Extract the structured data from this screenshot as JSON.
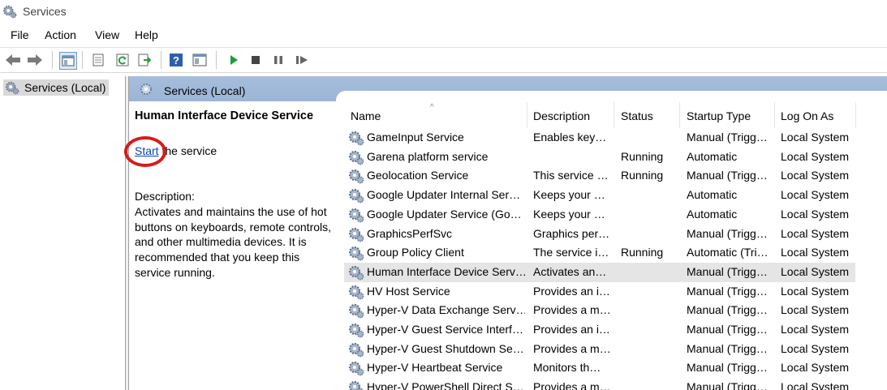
{
  "window": {
    "title": "Services"
  },
  "menu": [
    "File",
    "Action",
    "View",
    "Help"
  ],
  "tree": {
    "root_label": "Services (Local)"
  },
  "pane": {
    "header_label": "Services (Local)"
  },
  "extended": {
    "service_name": "Human Interface Device Service",
    "start_link": "Start",
    "start_suffix": " the service",
    "description_label": "Description:",
    "description": "Activates and maintains the use of hot buttons on keyboards, remote controls, and other multimedia devices. It is recommended that you keep this service running."
  },
  "columns": [
    "Name",
    "Description",
    "Status",
    "Startup Type",
    "Log On As"
  ],
  "rows": [
    {
      "name": "GameInput Service",
      "desc": "Enables key…",
      "status": "",
      "startup": "Manual (Trigg…",
      "logon": "Local System"
    },
    {
      "name": "Garena platform service",
      "desc": "",
      "status": "Running",
      "startup": "Automatic",
      "logon": "Local System"
    },
    {
      "name": "Geolocation Service",
      "desc": "This service …",
      "status": "Running",
      "startup": "Manual (Trigg…",
      "logon": "Local System"
    },
    {
      "name": "Google Updater Internal Ser…",
      "desc": "Keeps your …",
      "status": "",
      "startup": "Automatic",
      "logon": "Local System"
    },
    {
      "name": "Google Updater Service (Go…",
      "desc": "Keeps your …",
      "status": "",
      "startup": "Automatic",
      "logon": "Local System"
    },
    {
      "name": "GraphicsPerfSvc",
      "desc": "Graphics per…",
      "status": "",
      "startup": "Manual (Trigg…",
      "logon": "Local System"
    },
    {
      "name": "Group Policy Client",
      "desc": "The service i…",
      "status": "Running",
      "startup": "Automatic (Tri…",
      "logon": "Local System"
    },
    {
      "name": "Human Interface Device Serv…",
      "desc": "Activates an…",
      "status": "",
      "startup": "Manual (Trigg…",
      "logon": "Local System",
      "selected": true
    },
    {
      "name": "HV Host Service",
      "desc": "Provides an i…",
      "status": "",
      "startup": "Manual (Trigg…",
      "logon": "Local System"
    },
    {
      "name": "Hyper-V Data Exchange Serv…",
      "desc": "Provides a m…",
      "status": "",
      "startup": "Manual (Trigg…",
      "logon": "Local System"
    },
    {
      "name": "Hyper-V Guest Service Interf…",
      "desc": "Provides an i…",
      "status": "",
      "startup": "Manual (Trigg…",
      "logon": "Local System"
    },
    {
      "name": "Hyper-V Guest Shutdown Se…",
      "desc": "Provides a m…",
      "status": "",
      "startup": "Manual (Trigg…",
      "logon": "Local System"
    },
    {
      "name": "Hyper-V Heartbeat Service",
      "desc": "Monitors th…",
      "status": "",
      "startup": "Manual (Trigg…",
      "logon": "Local System"
    },
    {
      "name": "Hyper-V PowerShell Direct S…",
      "desc": "Provides a m…",
      "status": "",
      "startup": "Manual (Trigg…",
      "logon": "Local System"
    }
  ],
  "toolbar": [
    "back-icon",
    "forward-icon",
    "show-hide-tree-icon",
    "properties-icon",
    "refresh-icon",
    "export-list-icon",
    "help-icon",
    "view-icon",
    "start-service-icon",
    "stop-service-icon",
    "pause-service-icon",
    "resume-service-icon"
  ],
  "colors": {
    "header_blue": "#9cb5d6",
    "selected_row": "#e5e5e5",
    "annotation_red": "#d81b1b",
    "link": "#0645ad"
  }
}
